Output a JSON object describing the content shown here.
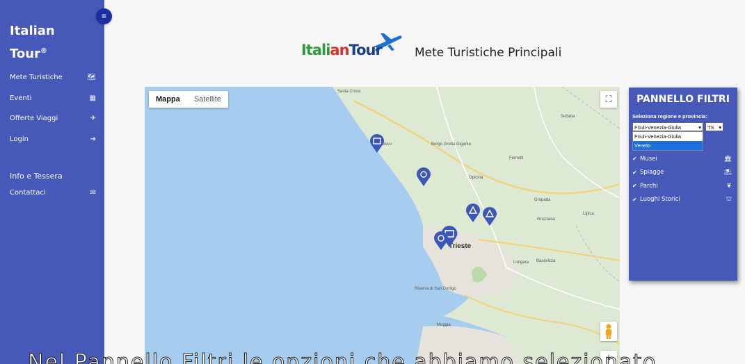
{
  "sidebar": {
    "brand_line1": "Italian",
    "brand_line2": "Tour",
    "brand_mark": "®",
    "toggle_icon": "hamburger-icon",
    "items": [
      {
        "label": "Mete Turistiche",
        "icon": "map-icon"
      },
      {
        "label": "Eventi",
        "icon": "calendar-icon"
      },
      {
        "label": "Offerte Viaggi",
        "icon": "plane-icon"
      },
      {
        "label": "Login",
        "icon": "login-icon"
      }
    ],
    "section_title": "Info e Tessera",
    "section_items": [
      {
        "label": "Contattaci",
        "icon": "envelope-icon"
      }
    ]
  },
  "header": {
    "logo_part1": "Itali",
    "logo_part2": "an",
    "logo_part3": "Tour",
    "title": "Mete Turistiche Principali"
  },
  "map": {
    "type_buttons": [
      "Mappa",
      "Satellite"
    ],
    "active_type": "Mappa",
    "city": "Trieste",
    "place_labels": [
      "Santa Croce",
      "Prosecco",
      "Borgo Grotta Gigante",
      "Opicina",
      "Basovizza",
      "Longera",
      "Grozzana",
      "Muggia",
      "Sežana",
      "Fernetti",
      "Gropada",
      "Lipica",
      "Riserva di San Dorligo"
    ],
    "colors": {
      "sea": "#a6cdf0",
      "land": "#dde9d3",
      "urban": "#e6e3dc",
      "marker": "#3d57b7"
    }
  },
  "panel": {
    "title": "PANNELLO FILTRI",
    "label": "Seleziona regione e provincia:",
    "region_selected": "Friuli-Venezia-Giulia",
    "province_selected": "TS",
    "dropdown_options": [
      "Friuli-Venezia-Giulia",
      "Veneto"
    ],
    "highlighted_option": "Veneto",
    "filters": [
      {
        "label": "Musei",
        "checked": true,
        "icon": "museum-icon"
      },
      {
        "label": "Spiagge",
        "checked": true,
        "icon": "umbrella-icon"
      },
      {
        "label": "Parchi",
        "checked": true,
        "icon": "leaf-icon"
      },
      {
        "label": "Luoghi Storici",
        "checked": true,
        "icon": "landmark-icon"
      }
    ]
  },
  "subtitle": "Nel Pannello Filtri le opzioni che abbiamo selezionato"
}
